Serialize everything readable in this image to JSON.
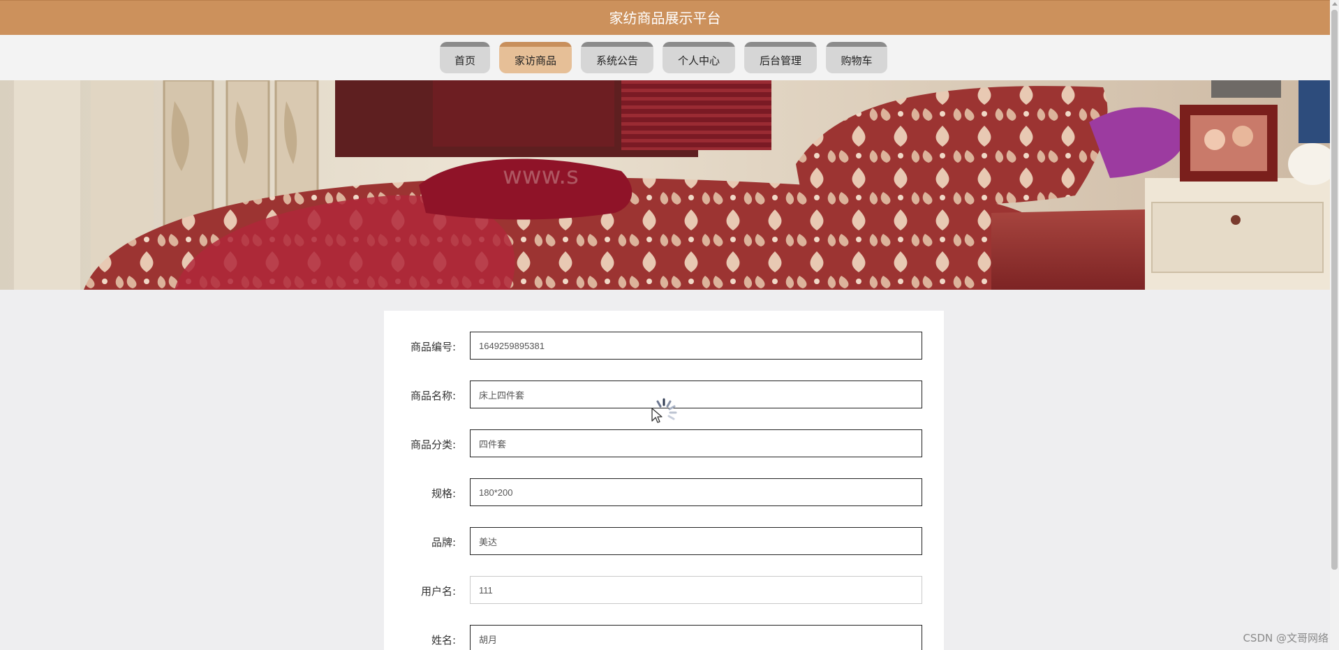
{
  "header": {
    "title": "家纺商品展示平台"
  },
  "nav": {
    "items": [
      {
        "label": "首页",
        "active": false
      },
      {
        "label": "家访商品",
        "active": true
      },
      {
        "label": "系统公告",
        "active": false
      },
      {
        "label": "个人中心",
        "active": false
      },
      {
        "label": "后台管理",
        "active": false
      },
      {
        "label": "购物车",
        "active": false
      }
    ]
  },
  "form": {
    "fields": [
      {
        "label": "商品编号:",
        "value": "1649259895381"
      },
      {
        "label": "商品名称:",
        "value": "床上四件套"
      },
      {
        "label": "商品分类:",
        "value": "四件套"
      },
      {
        "label": "规格:",
        "value": "180*200"
      },
      {
        "label": "品牌:",
        "value": "美达"
      },
      {
        "label": "用户名:",
        "value": "111"
      },
      {
        "label": "姓名:",
        "value": "胡月"
      }
    ]
  },
  "watermark": "CSDN @文哥网络",
  "colors": {
    "header_bg": "#cc915c",
    "nav_active_bg": "#e6bf97",
    "nav_bg": "#d6d6d6"
  }
}
